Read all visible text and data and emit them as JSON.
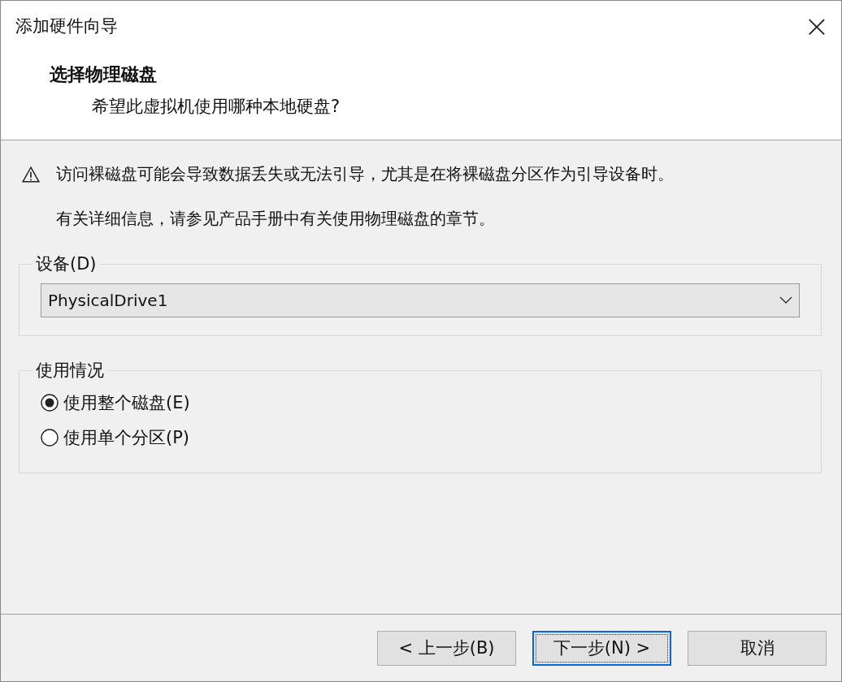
{
  "window": {
    "title": "添加硬件向导",
    "close": "×"
  },
  "header": {
    "title": "选择物理磁盘",
    "subtitle": "希望此虚拟机使用哪种本地硬盘?"
  },
  "warning": {
    "text": "访问裸磁盘可能会导致数据丢失或无法引导，尤其是在将裸磁盘分区作为引导设备时。",
    "note": "有关详细信息，请参见产品手册中有关使用物理磁盘的章节。"
  },
  "device_group": {
    "label": "设备(D)",
    "value": "PhysicalDrive1"
  },
  "usage_group": {
    "label": "使用情况",
    "options": [
      {
        "label": "使用整个磁盘(E)",
        "selected": true
      },
      {
        "label": "使用单个分区(P)",
        "selected": false
      }
    ]
  },
  "buttons": [
    {
      "label": "< 上一步(B)",
      "focused": false
    },
    {
      "label": "下一步(N) >",
      "focused": true
    },
    {
      "label": "取消",
      "focused": false
    }
  ]
}
